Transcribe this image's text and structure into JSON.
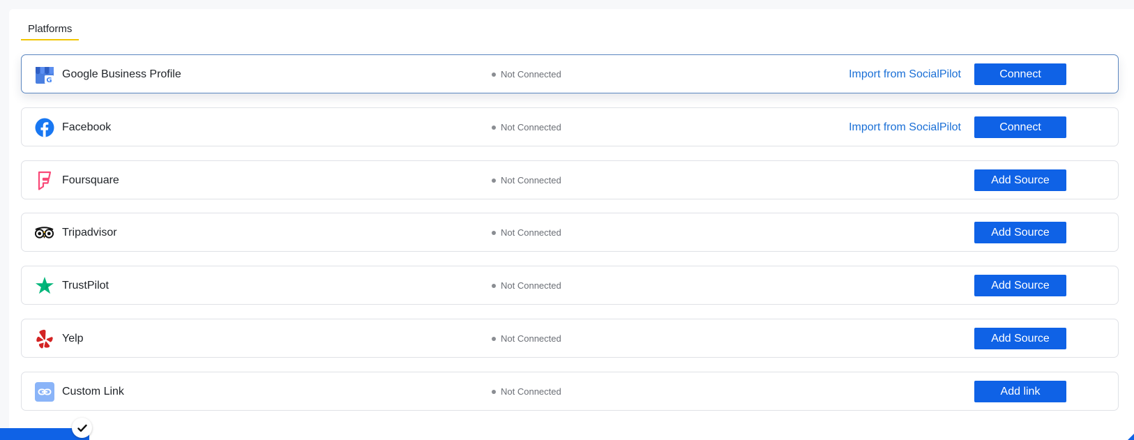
{
  "header": {
    "tab_label": "Platforms"
  },
  "platforms": [
    {
      "name": "Google Business Profile",
      "icon": "google-business-icon",
      "status": "Not Connected",
      "import_label": "Import from SocialPilot",
      "action_label": "Connect"
    },
    {
      "name": "Facebook",
      "icon": "facebook-icon",
      "status": "Not Connected",
      "import_label": "Import from SocialPilot",
      "action_label": "Connect"
    },
    {
      "name": "Foursquare",
      "icon": "foursquare-icon",
      "status": "Not Connected",
      "action_label": "Add Source"
    },
    {
      "name": "Tripadvisor",
      "icon": "tripadvisor-icon",
      "status": "Not Connected",
      "action_label": "Add Source"
    },
    {
      "name": "TrustPilot",
      "icon": "trustpilot-icon",
      "status": "Not Connected",
      "action_label": "Add Source"
    },
    {
      "name": "Yelp",
      "icon": "yelp-icon",
      "status": "Not Connected",
      "action_label": "Add Source"
    },
    {
      "name": "Custom Link",
      "icon": "link-icon",
      "status": "Not Connected",
      "action_label": "Add link"
    }
  ],
  "footer": {
    "check_icon": "check-icon"
  },
  "colors": {
    "primary": "#0f62e6",
    "link": "#1a6fd6",
    "tab_underline": "#f2c500",
    "active_border": "#5a86c0",
    "foursquare": "#f94877",
    "trustpilot": "#00b67a",
    "yelp": "#d32323",
    "facebook": "#1877f2"
  }
}
